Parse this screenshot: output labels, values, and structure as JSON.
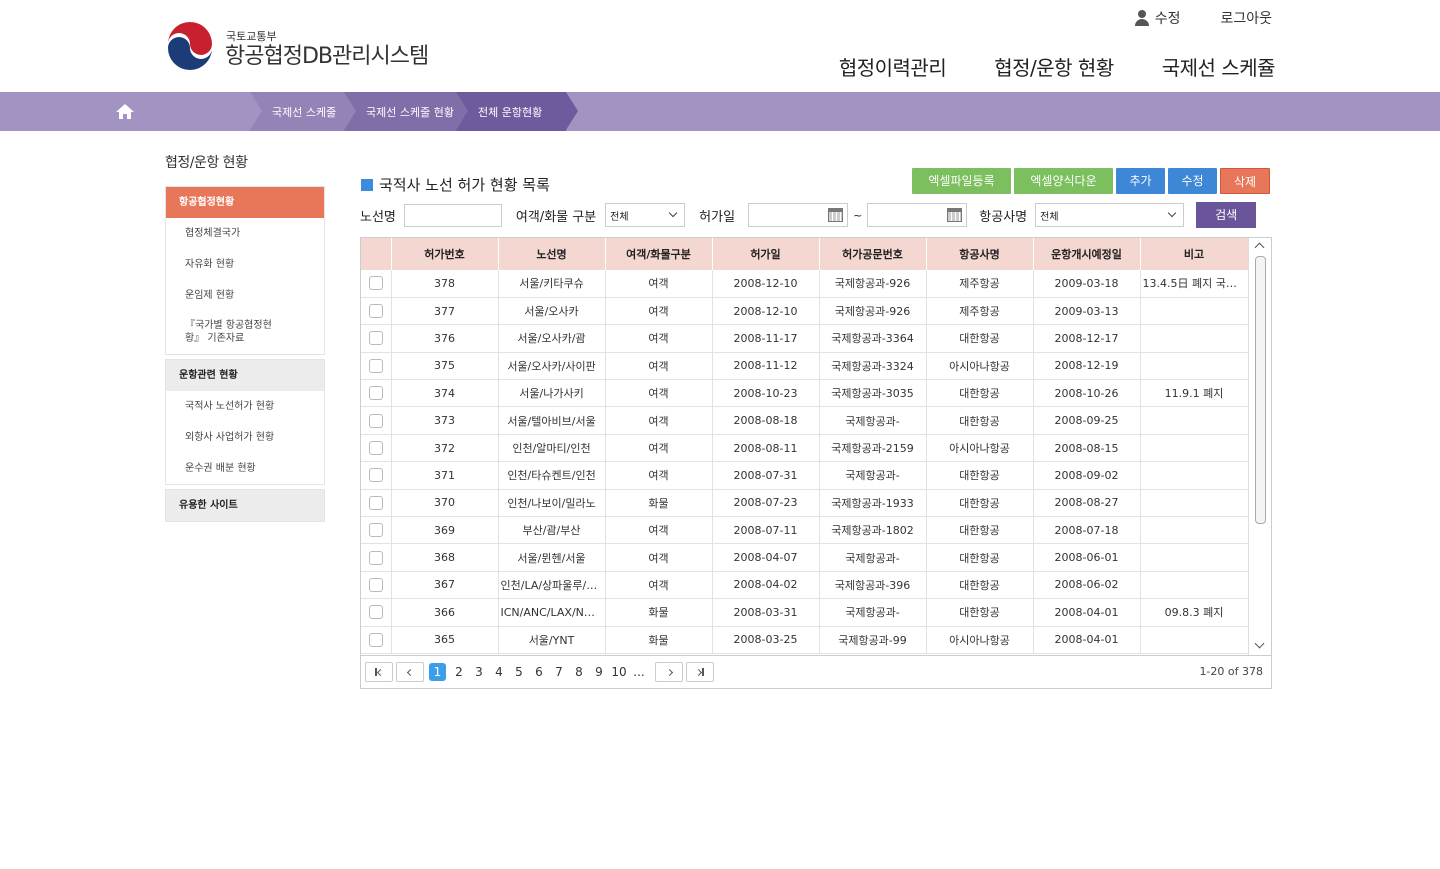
{
  "header": {
    "ministry": "국토교통부",
    "system_title": "항공협정DB관리시스템",
    "util": {
      "edit": "수정",
      "logout": "로그아웃"
    },
    "gnb": [
      "협정이력관리",
      "협정/운항 현황",
      "국제선 스케쥴"
    ]
  },
  "breadcrumb": [
    "국제선 스케줄",
    "국제선 스케줄 현황",
    "전체 운항현황"
  ],
  "sidebar": {
    "title": "협정/운항 현황",
    "groups": [
      {
        "head": "항공협정현황",
        "items": [
          "협정체결국가",
          "자유화 현황",
          "운임제 현황",
          "『국가별 항공협정현황』 기존자료"
        ]
      },
      {
        "head": "운항관련 현황",
        "items": [
          "국적사 노선허가 현황",
          "외항사 사업허가 현황",
          "운수권 배분 현황"
        ]
      },
      {
        "head": "유용한 사이트",
        "items": []
      }
    ]
  },
  "main": {
    "title": "국적사 노선 허가 현황 목록",
    "buttons": {
      "excel_upload": "엑셀파일등록",
      "excel_download": "엑셀양식다운",
      "add": "추가",
      "edit": "수정",
      "delete": "삭제"
    },
    "search": {
      "route_label": "노선명",
      "route_value": "",
      "type_label": "여객/화물 구분",
      "type_value": "전체",
      "date_label": "허가일",
      "date_tilde": "~",
      "airline_label": "항공사명",
      "airline_value": "전체",
      "search_button": "검색"
    }
  },
  "table": {
    "columns": [
      "허가번호",
      "노선명",
      "여객/화물구분",
      "허가일",
      "허가공문번호",
      "항공사명",
      "운항개시예정일",
      "비고"
    ],
    "rows": [
      [
        "378",
        "서울/키타쿠슈",
        "여객",
        "2008-12-10",
        "국제항공과-926",
        "제주항공",
        "2009-03-18",
        "13.4.5日 폐지 국제..."
      ],
      [
        "377",
        "서울/오사카",
        "여객",
        "2008-12-10",
        "국제항공과-926",
        "제주항공",
        "2009-03-13",
        ""
      ],
      [
        "376",
        "서울/오사카/괌",
        "여객",
        "2008-11-17",
        "국제항공과-3364",
        "대한항공",
        "2008-12-17",
        ""
      ],
      [
        "375",
        "서울/오사카/사이판",
        "여객",
        "2008-11-12",
        "국제항공과-3324",
        "아시아나항공",
        "2008-12-19",
        ""
      ],
      [
        "374",
        "서울/나가사키",
        "여객",
        "2008-10-23",
        "국제항공과-3035",
        "대한항공",
        "2008-10-26",
        "11.9.1 폐지"
      ],
      [
        "373",
        "서울/텔아비브/서울",
        "여객",
        "2008-08-18",
        "국제항공과-",
        "대한항공",
        "2008-09-25",
        ""
      ],
      [
        "372",
        "인천/알마티/인천",
        "여객",
        "2008-08-11",
        "국제항공과-2159",
        "아시아나항공",
        "2008-08-15",
        ""
      ],
      [
        "371",
        "인천/타슈켄트/인천",
        "여객",
        "2008-07-31",
        "국제항공과-",
        "대한항공",
        "2008-09-02",
        ""
      ],
      [
        "370",
        "인천/나보이/밀라노",
        "화물",
        "2008-07-23",
        "국제항공과-1933",
        "대한항공",
        "2008-08-27",
        ""
      ],
      [
        "369",
        "부산/괌/부산",
        "여객",
        "2008-07-11",
        "국제항공과-1802",
        "대한항공",
        "2008-07-18",
        ""
      ],
      [
        "368",
        "서울/뮌헨/서울",
        "여객",
        "2008-04-07",
        "국제항공과-",
        "대한항공",
        "2008-06-01",
        ""
      ],
      [
        "367",
        "인천/LA/상파울루/L...",
        "여객",
        "2008-04-02",
        "국제항공과-396",
        "대한항공",
        "2008-06-02",
        ""
      ],
      [
        "366",
        "ICN/ANC/LAX/NG...",
        "화물",
        "2008-03-31",
        "국제항공과-",
        "대한항공",
        "2008-04-01",
        "09.8.3 폐지"
      ],
      [
        "365",
        "서울/YNT",
        "화물",
        "2008-03-25",
        "국제항공과-99",
        "아시아나항공",
        "2008-04-01",
        ""
      ]
    ]
  },
  "pager": {
    "pages": [
      "1",
      "2",
      "3",
      "4",
      "5",
      "6",
      "7",
      "8",
      "9",
      "10",
      "..."
    ],
    "current": "1",
    "summary": "1-20 of 378"
  }
}
